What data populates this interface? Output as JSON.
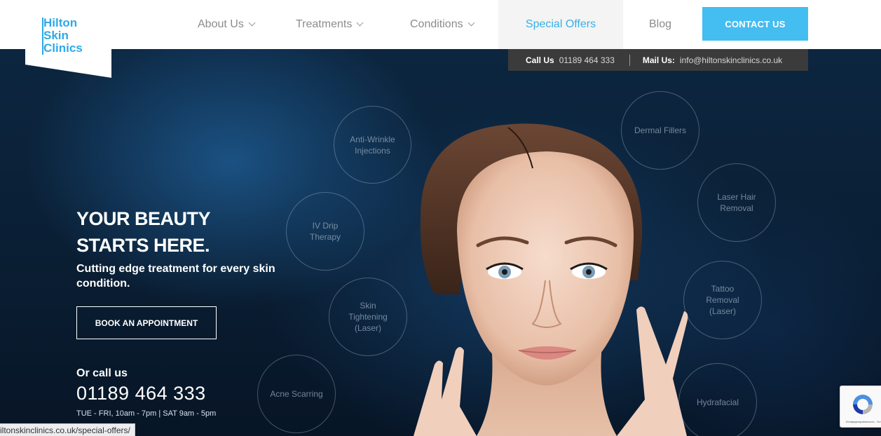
{
  "brand": {
    "logo_lines": [
      "Hilton",
      "Skin",
      "Clinics"
    ]
  },
  "nav": {
    "items": [
      {
        "label": "About Us",
        "has_dropdown": true
      },
      {
        "label": "Treatments",
        "has_dropdown": true
      },
      {
        "label": "Conditions",
        "has_dropdown": true
      },
      {
        "label": "Special Offers",
        "has_dropdown": false,
        "active": true
      },
      {
        "label": "Blog",
        "has_dropdown": false
      }
    ],
    "contact_button": "CONTACT US"
  },
  "contact_strip": {
    "call_label": "Call Us",
    "call_value": "01189 464 333",
    "mail_label": "Mail Us:",
    "mail_value": "info@hiltonskinclinics.co.uk"
  },
  "hero": {
    "headline_line1": "YOUR BEAUTY",
    "headline_line2": "STARTS HERE.",
    "subline": "Cutting edge treatment for every skin condition.",
    "cta": "BOOK AN APPOINTMENT",
    "or_call": "Or call us",
    "phone": "01189 464 333",
    "hours": "TUE - FRI, 10am - 7pm | SAT 9am - 5pm"
  },
  "treatments": [
    {
      "label": "Anti-Wrinkle Injections"
    },
    {
      "label": "IV Drip Therapy"
    },
    {
      "label": "Skin Tightening (Laser)"
    },
    {
      "label": "Acne Scarring"
    },
    {
      "label": "Dermal Fillers"
    },
    {
      "label": "Laser Hair Removal"
    },
    {
      "label": "Tattoo Removal (Laser)"
    },
    {
      "label": "Hydrafacial"
    }
  ],
  "status_bar": {
    "url": "iltonskinclinics.co.uk/special-offers/"
  },
  "recaptcha": {
    "text": "Конфиденциальность - Условия использования"
  },
  "colors": {
    "accent": "#44bdf1",
    "logo": "#2fa9e8",
    "active_nav": "#36b0e8",
    "hero_bg": "#0c2640"
  }
}
